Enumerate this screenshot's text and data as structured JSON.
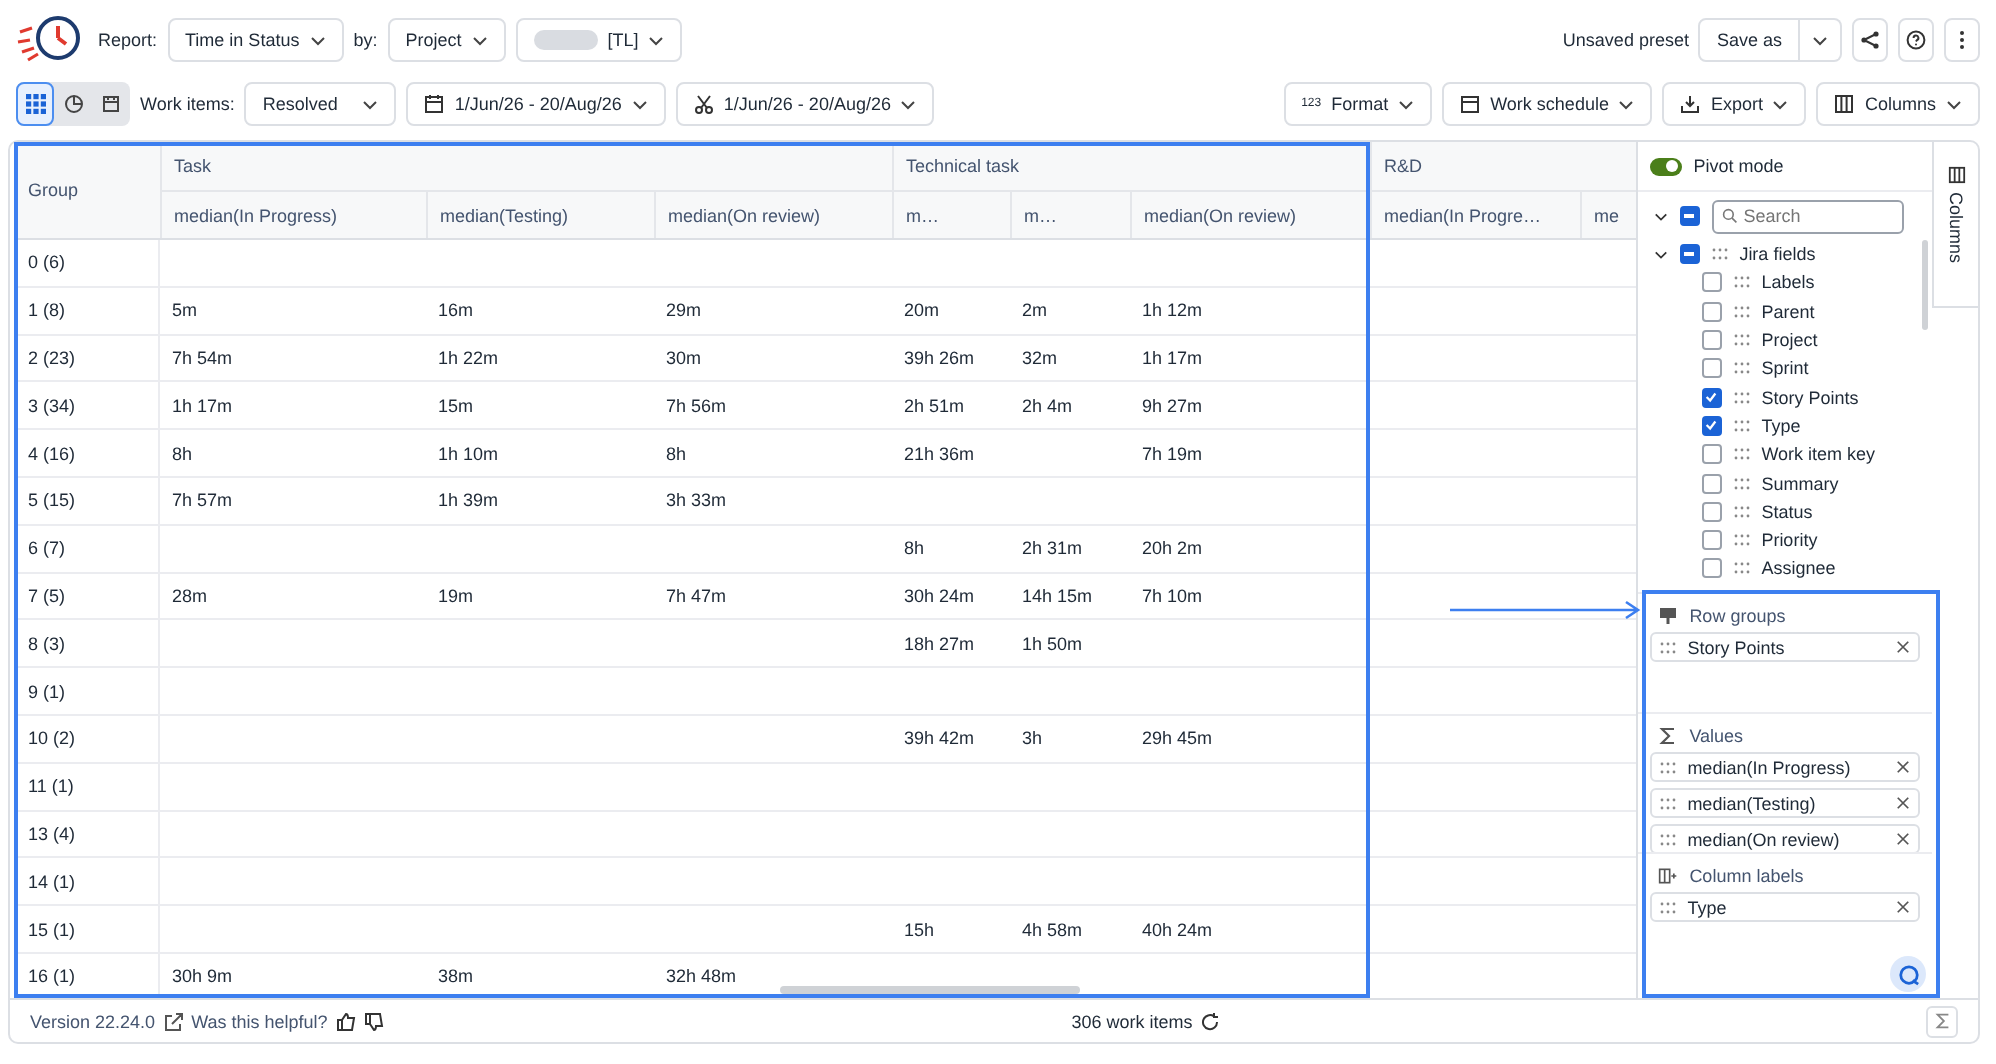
{
  "header": {
    "report_label": "Report:",
    "report": "Time in Status",
    "by_label": "by:",
    "by": "Project",
    "project_chip": "[TL]",
    "preset_status": "Unsaved preset",
    "save_button": "Save as"
  },
  "toolbar": {
    "views": [
      {
        "kind": "grid",
        "selected": true
      },
      {
        "kind": "chart",
        "selected": false
      },
      {
        "kind": "calendar",
        "selected": false
      }
    ],
    "work_items_label": "Work items:",
    "work_items": "Resolved",
    "date_range": "1/Jun/26 - 20/Aug/26",
    "cut_range": "1/Jun/26 - 20/Aug/26",
    "format_badge": "123",
    "format": "Format",
    "work_schedule": "Work schedule",
    "export": "Export",
    "columns": "Columns"
  },
  "table": {
    "group_header": "Group",
    "column_groups": [
      {
        "label": "Task",
        "columns": [
          "median(In Progress)",
          "median(Testing)",
          "median(On review)"
        ]
      },
      {
        "label": "Technical task",
        "columns": [
          "m…",
          "m…",
          "median(On review)"
        ]
      },
      {
        "label": "R&D",
        "columns": [
          "median(In Progre…",
          "me"
        ]
      }
    ],
    "rows": [
      {
        "group": "0 (6)",
        "cells": [
          null,
          null,
          null,
          null,
          null,
          null,
          null,
          null
        ]
      },
      {
        "group": "1 (8)",
        "cells": [
          "5m",
          "16m",
          "29m",
          "20m",
          "2m",
          "1h 12m",
          null,
          null
        ]
      },
      {
        "group": "2 (23)",
        "cells": [
          "7h 54m",
          "1h 22m",
          "30m",
          "39h 26m",
          "32m",
          "1h 17m",
          null,
          null
        ]
      },
      {
        "group": "3 (34)",
        "cells": [
          "1h 17m",
          "15m",
          "7h 56m",
          "2h 51m",
          "2h 4m",
          "9h 27m",
          null,
          null
        ]
      },
      {
        "group": "4 (16)",
        "cells": [
          "8h",
          "1h 10m",
          "8h",
          "21h 36m",
          null,
          "7h 19m",
          null,
          null
        ]
      },
      {
        "group": "5 (15)",
        "cells": [
          "7h 57m",
          "1h 39m",
          "3h 33m",
          null,
          null,
          null,
          null,
          null
        ]
      },
      {
        "group": "6 (7)",
        "cells": [
          null,
          null,
          null,
          "8h",
          "2h 31m",
          "20h 2m",
          null,
          null
        ]
      },
      {
        "group": "7 (5)",
        "cells": [
          "28m",
          "19m",
          "7h 47m",
          "30h 24m",
          "14h 15m",
          "7h 10m",
          null,
          null
        ]
      },
      {
        "group": "8 (3)",
        "cells": [
          null,
          null,
          null,
          "18h 27m",
          "1h 50m",
          null,
          null,
          null
        ]
      },
      {
        "group": "9 (1)",
        "cells": [
          null,
          null,
          null,
          null,
          null,
          null,
          null,
          null
        ]
      },
      {
        "group": "10 (2)",
        "cells": [
          null,
          null,
          null,
          "39h 42m",
          "3h",
          "29h 45m",
          null,
          null
        ]
      },
      {
        "group": "11 (1)",
        "cells": [
          null,
          null,
          null,
          null,
          null,
          null,
          null,
          null
        ]
      },
      {
        "group": "13 (4)",
        "cells": [
          null,
          null,
          null,
          null,
          null,
          null,
          null,
          null
        ]
      },
      {
        "group": "14 (1)",
        "cells": [
          null,
          null,
          null,
          null,
          null,
          null,
          null,
          null
        ]
      },
      {
        "group": "15 (1)",
        "cells": [
          null,
          null,
          null,
          "15h",
          "4h 58m",
          "40h 24m",
          null,
          null
        ]
      },
      {
        "group": "16 (1)",
        "cells": [
          "30h 9m",
          "38m",
          "32h 48m",
          null,
          null,
          null,
          null,
          null
        ]
      }
    ]
  },
  "side_panel": {
    "pivot_mode": {
      "label": "Pivot mode",
      "on": true
    },
    "select_all": {
      "indeterminate": true
    },
    "search_placeholder": "Search",
    "field_group": {
      "label": "Jira fields",
      "expanded": true,
      "indeterminate": true,
      "children": [
        {
          "label": "Labels",
          "checked": false
        },
        {
          "label": "Parent",
          "checked": false
        },
        {
          "label": "Project",
          "checked": false
        },
        {
          "label": "Sprint",
          "checked": false
        },
        {
          "label": "Story Points",
          "checked": true
        },
        {
          "label": "Type",
          "checked": true
        },
        {
          "label": "Work item key",
          "checked": false
        },
        {
          "label": "Summary",
          "checked": false
        },
        {
          "label": "Status",
          "checked": false
        },
        {
          "label": "Priority",
          "checked": false
        },
        {
          "label": "Assignee",
          "checked": false
        }
      ]
    },
    "sections": [
      {
        "kind": "row_groups",
        "title": "Row groups",
        "items": [
          "Story Points"
        ]
      },
      {
        "kind": "values",
        "title": "Values",
        "items": [
          "median(In Progress)",
          "median(Testing)",
          "median(On review)"
        ]
      },
      {
        "kind": "column_labels",
        "title": "Column labels",
        "items": [
          "Type"
        ]
      }
    ],
    "side_tab": "Columns"
  },
  "footer": {
    "version": "Version 22.24.0",
    "feedback": "Was this helpful?",
    "count": "306 work items"
  }
}
